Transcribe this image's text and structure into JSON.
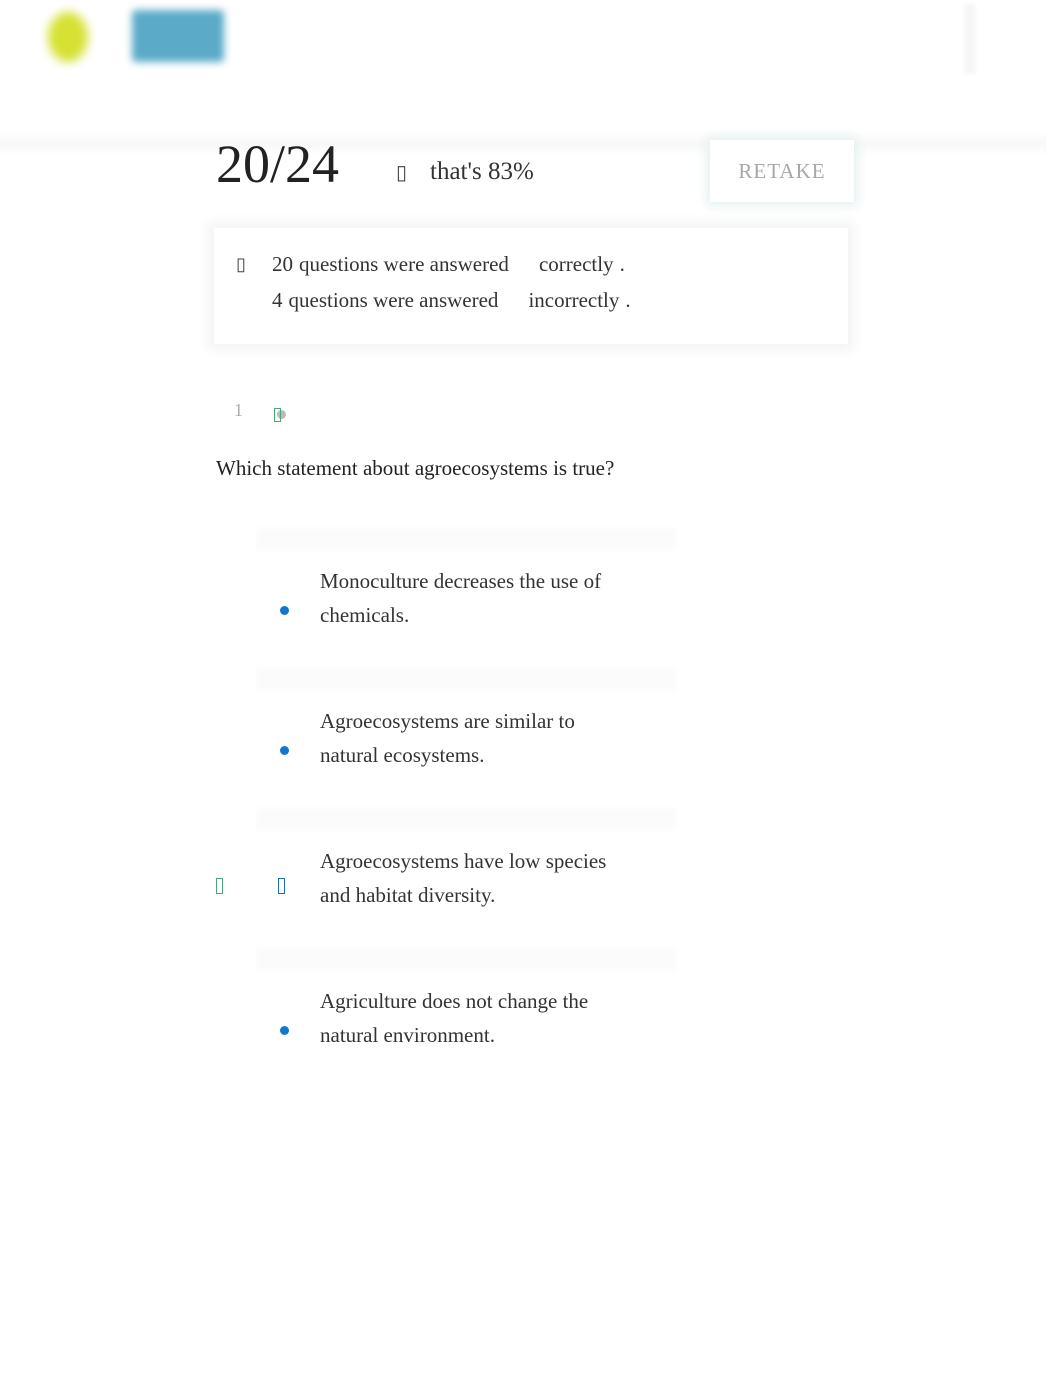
{
  "header": {
    "logo_icon": "logo-blob",
    "brand_icon": "brand-logo"
  },
  "result": {
    "score": "20/24",
    "percent_icon": "info-icon",
    "percent_text": "that's 83%",
    "retake_label": "RETAKE"
  },
  "summary": {
    "icon": "info-icon",
    "correct_count": "20",
    "correct_text": "questions were answered",
    "correct_word": "correctly",
    "incorrect_count": "4",
    "incorrect_text": "questions were answered",
    "incorrect_word": "incorrectly",
    "period": "."
  },
  "question": {
    "number": "1",
    "text": "Which statement about agroecosystems is true?",
    "options": [
      {
        "text": "Monoculture decreases the use of chemicals.",
        "selected": false,
        "correct": false
      },
      {
        "text": "Agroecosystems are similar to natural ecosystems.",
        "selected": false,
        "correct": false
      },
      {
        "text": "Agroecosystems have low species and habitat diversity.",
        "selected": true,
        "correct": true
      },
      {
        "text": "Agriculture does not change the natural environment.",
        "selected": false,
        "correct": false
      }
    ]
  },
  "colors": {
    "accent": "#1177cc",
    "correct": "#4aa878",
    "muted": "#a8a8a8"
  }
}
